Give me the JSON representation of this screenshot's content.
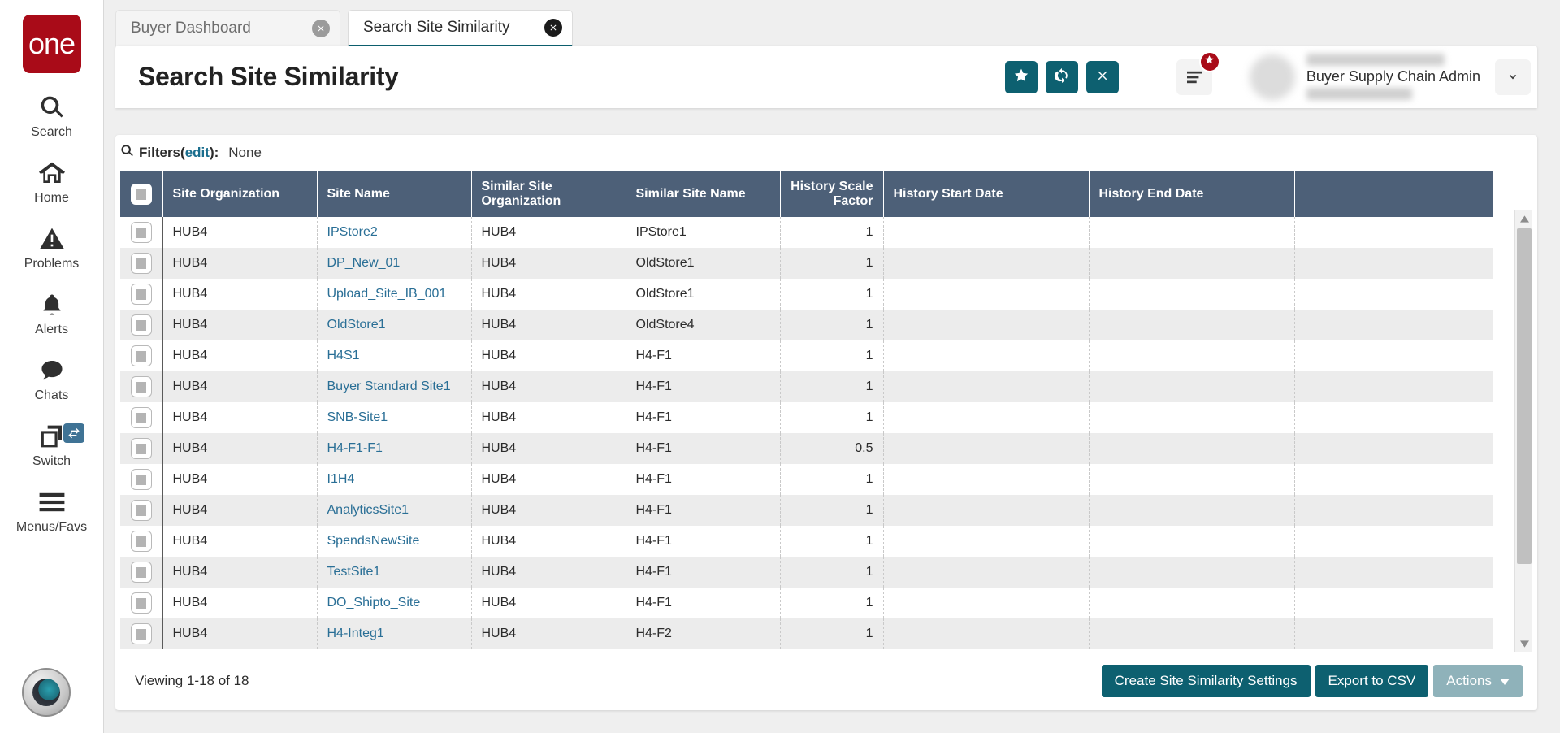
{
  "sidebar": {
    "logo_text": "one",
    "items": [
      {
        "label": "Search",
        "icon": "search-icon"
      },
      {
        "label": "Home",
        "icon": "home-icon"
      },
      {
        "label": "Problems",
        "icon": "warning-triangle-icon"
      },
      {
        "label": "Alerts",
        "icon": "bell-icon"
      },
      {
        "label": "Chats",
        "icon": "chat-bubble-icon"
      },
      {
        "label": "Switch",
        "icon": "switch-windows-icon"
      },
      {
        "label": "Menus/Favs",
        "icon": "hamburger-icon"
      }
    ],
    "assistant_icon": "ai-assistant-avatar-icon"
  },
  "tabs": [
    {
      "label": "Buyer Dashboard",
      "active": false
    },
    {
      "label": "Search Site Similarity",
      "active": true
    }
  ],
  "header": {
    "title": "Search Site Similarity",
    "buttons": [
      {
        "name": "favorite-button",
        "icon": "star-icon"
      },
      {
        "name": "refresh-button",
        "icon": "refresh-icon"
      },
      {
        "name": "close-button",
        "icon": "x-icon"
      }
    ],
    "menu_icon": "menu-lines-icon",
    "menu_badge_icon": "star-icon",
    "user_role": "Buyer Supply Chain Admin",
    "caret_icon": "chevron-down-icon"
  },
  "filters": {
    "icon": "search-icon",
    "label": "Filters",
    "edit_link": "edit",
    "paren_open": " (",
    "paren_close": "):",
    "value": "None"
  },
  "table": {
    "columns": [
      "Site Organization",
      "Site Name",
      "Similar Site Organization",
      "Similar Site Name",
      "History Scale Factor",
      "History Start Date",
      "History End Date"
    ],
    "rows": [
      {
        "site_org": "HUB4",
        "site_name": "IPStore2",
        "similar_org": "HUB4",
        "similar_site": "IPStore1",
        "scale": "1",
        "start": "",
        "end": ""
      },
      {
        "site_org": "HUB4",
        "site_name": "DP_New_01",
        "similar_org": "HUB4",
        "similar_site": "OldStore1",
        "scale": "1",
        "start": "",
        "end": ""
      },
      {
        "site_org": "HUB4",
        "site_name": "Upload_Site_IB_001",
        "similar_org": "HUB4",
        "similar_site": "OldStore1",
        "scale": "1",
        "start": "",
        "end": ""
      },
      {
        "site_org": "HUB4",
        "site_name": "OldStore1",
        "similar_org": "HUB4",
        "similar_site": "OldStore4",
        "scale": "1",
        "start": "",
        "end": ""
      },
      {
        "site_org": "HUB4",
        "site_name": "H4S1",
        "similar_org": "HUB4",
        "similar_site": "H4-F1",
        "scale": "1",
        "start": "",
        "end": ""
      },
      {
        "site_org": "HUB4",
        "site_name": "Buyer Standard Site1",
        "similar_org": "HUB4",
        "similar_site": "H4-F1",
        "scale": "1",
        "start": "",
        "end": ""
      },
      {
        "site_org": "HUB4",
        "site_name": "SNB-Site1",
        "similar_org": "HUB4",
        "similar_site": "H4-F1",
        "scale": "1",
        "start": "",
        "end": ""
      },
      {
        "site_org": "HUB4",
        "site_name": "H4-F1-F1",
        "similar_org": "HUB4",
        "similar_site": "H4-F1",
        "scale": "0.5",
        "start": "",
        "end": ""
      },
      {
        "site_org": "HUB4",
        "site_name": "I1H4",
        "similar_org": "HUB4",
        "similar_site": "H4-F1",
        "scale": "1",
        "start": "",
        "end": ""
      },
      {
        "site_org": "HUB4",
        "site_name": "AnalyticsSite1",
        "similar_org": "HUB4",
        "similar_site": "H4-F1",
        "scale": "1",
        "start": "",
        "end": ""
      },
      {
        "site_org": "HUB4",
        "site_name": "SpendsNewSite",
        "similar_org": "HUB4",
        "similar_site": "H4-F1",
        "scale": "1",
        "start": "",
        "end": ""
      },
      {
        "site_org": "HUB4",
        "site_name": "TestSite1",
        "similar_org": "HUB4",
        "similar_site": "H4-F1",
        "scale": "1",
        "start": "",
        "end": ""
      },
      {
        "site_org": "HUB4",
        "site_name": "DO_Shipto_Site",
        "similar_org": "HUB4",
        "similar_site": "H4-F1",
        "scale": "1",
        "start": "",
        "end": ""
      },
      {
        "site_org": "HUB4",
        "site_name": "H4-Integ1",
        "similar_org": "HUB4",
        "similar_site": "H4-F2",
        "scale": "1",
        "start": "",
        "end": ""
      }
    ]
  },
  "footer": {
    "viewing": "Viewing 1-18 of 18",
    "create_label": "Create Site Similarity Settings",
    "export_label": "Export to CSV",
    "actions_label": "Actions"
  },
  "colors": {
    "brand_red": "#a90b18",
    "teal": "#0d6070",
    "header_row": "#4d6078",
    "link": "#2a6f96",
    "muted_teal": "#8fb2ba"
  }
}
